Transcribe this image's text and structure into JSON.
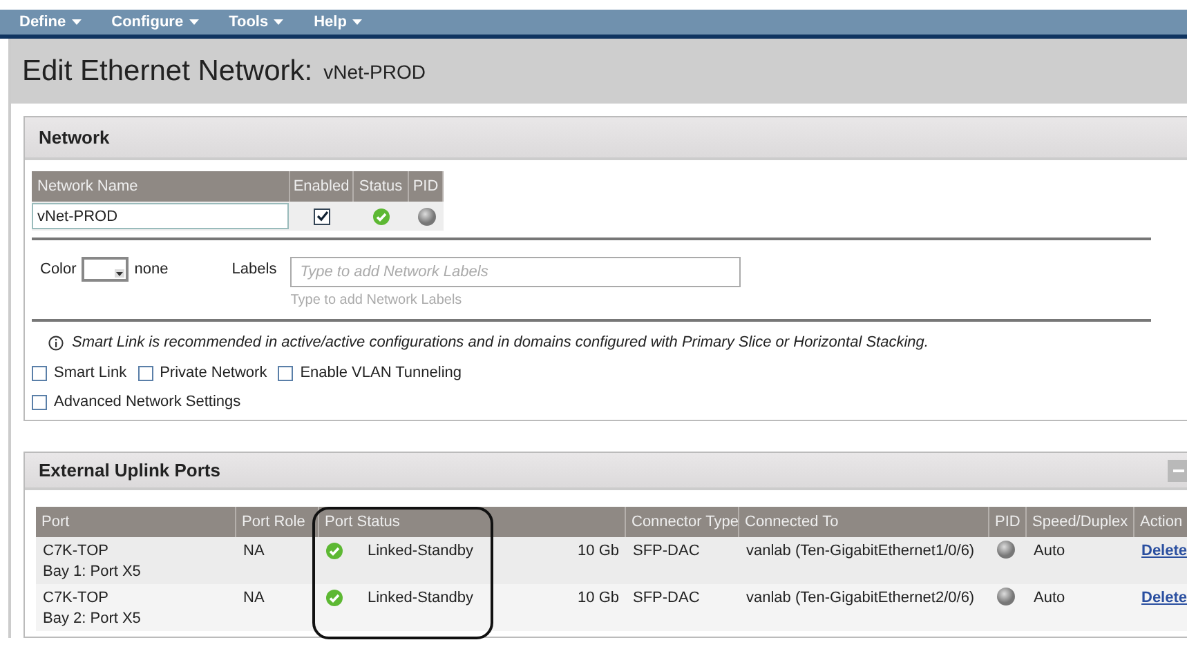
{
  "menu": [
    {
      "label": "Define"
    },
    {
      "label": "Configure"
    },
    {
      "label": "Tools"
    },
    {
      "label": "Help"
    }
  ],
  "title": {
    "label": "Edit Ethernet Network:",
    "name": "vNet-PROD"
  },
  "network": {
    "title": "Network",
    "columns": [
      "Network Name",
      "Enabled",
      "Status",
      "PID"
    ],
    "row": {
      "network_name": "vNet-PROD",
      "enabled": true,
      "status_ok": true,
      "pid": false
    },
    "color": {
      "label": "Color",
      "value": "none"
    },
    "labels": {
      "label": "Labels",
      "placeholder": "Type to add Network Labels",
      "hint": "Type to add Network Labels"
    },
    "info": "Smart Link is recommended in active/active configurations and in domains configured with Primary Slice or Horizontal Stacking.",
    "options": [
      {
        "label": "Smart Link",
        "checked": false
      },
      {
        "label": "Private Network",
        "checked": false
      },
      {
        "label": "Enable VLAN Tunneling",
        "checked": false
      },
      {
        "label": "Advanced Network Settings",
        "checked": false
      }
    ]
  },
  "uplinks": {
    "title": "External Uplink Ports",
    "columns": [
      "Port",
      "Port Role",
      "Port Status",
      "Connector Type",
      "Connected To",
      "PID",
      "Speed/Duplex",
      "Action"
    ],
    "rows": [
      {
        "port": "C7K-TOP",
        "bay": "Bay 1: Port X5",
        "port_role": "NA",
        "status_ok": true,
        "port_status": "Linked-Standby",
        "column_4": "10 Gb",
        "connector_type": "SFP-DAC",
        "connected_to": "vanlab (Ten-GigabitEthernet1/0/6)",
        "pid": false,
        "speed_duplex": "Auto",
        "action": "Delete"
      },
      {
        "port": "C7K-TOP",
        "bay": "Bay 2: Port X5",
        "port_role": "NA",
        "status_ok": true,
        "port_status": "Linked-Standby",
        "column_4": "10 Gb",
        "connector_type": "SFP-DAC",
        "connected_to": "vanlab (Ten-GigabitEthernet2/0/6)",
        "pid": false,
        "speed_duplex": "Auto",
        "action": "Delete"
      }
    ]
  }
}
